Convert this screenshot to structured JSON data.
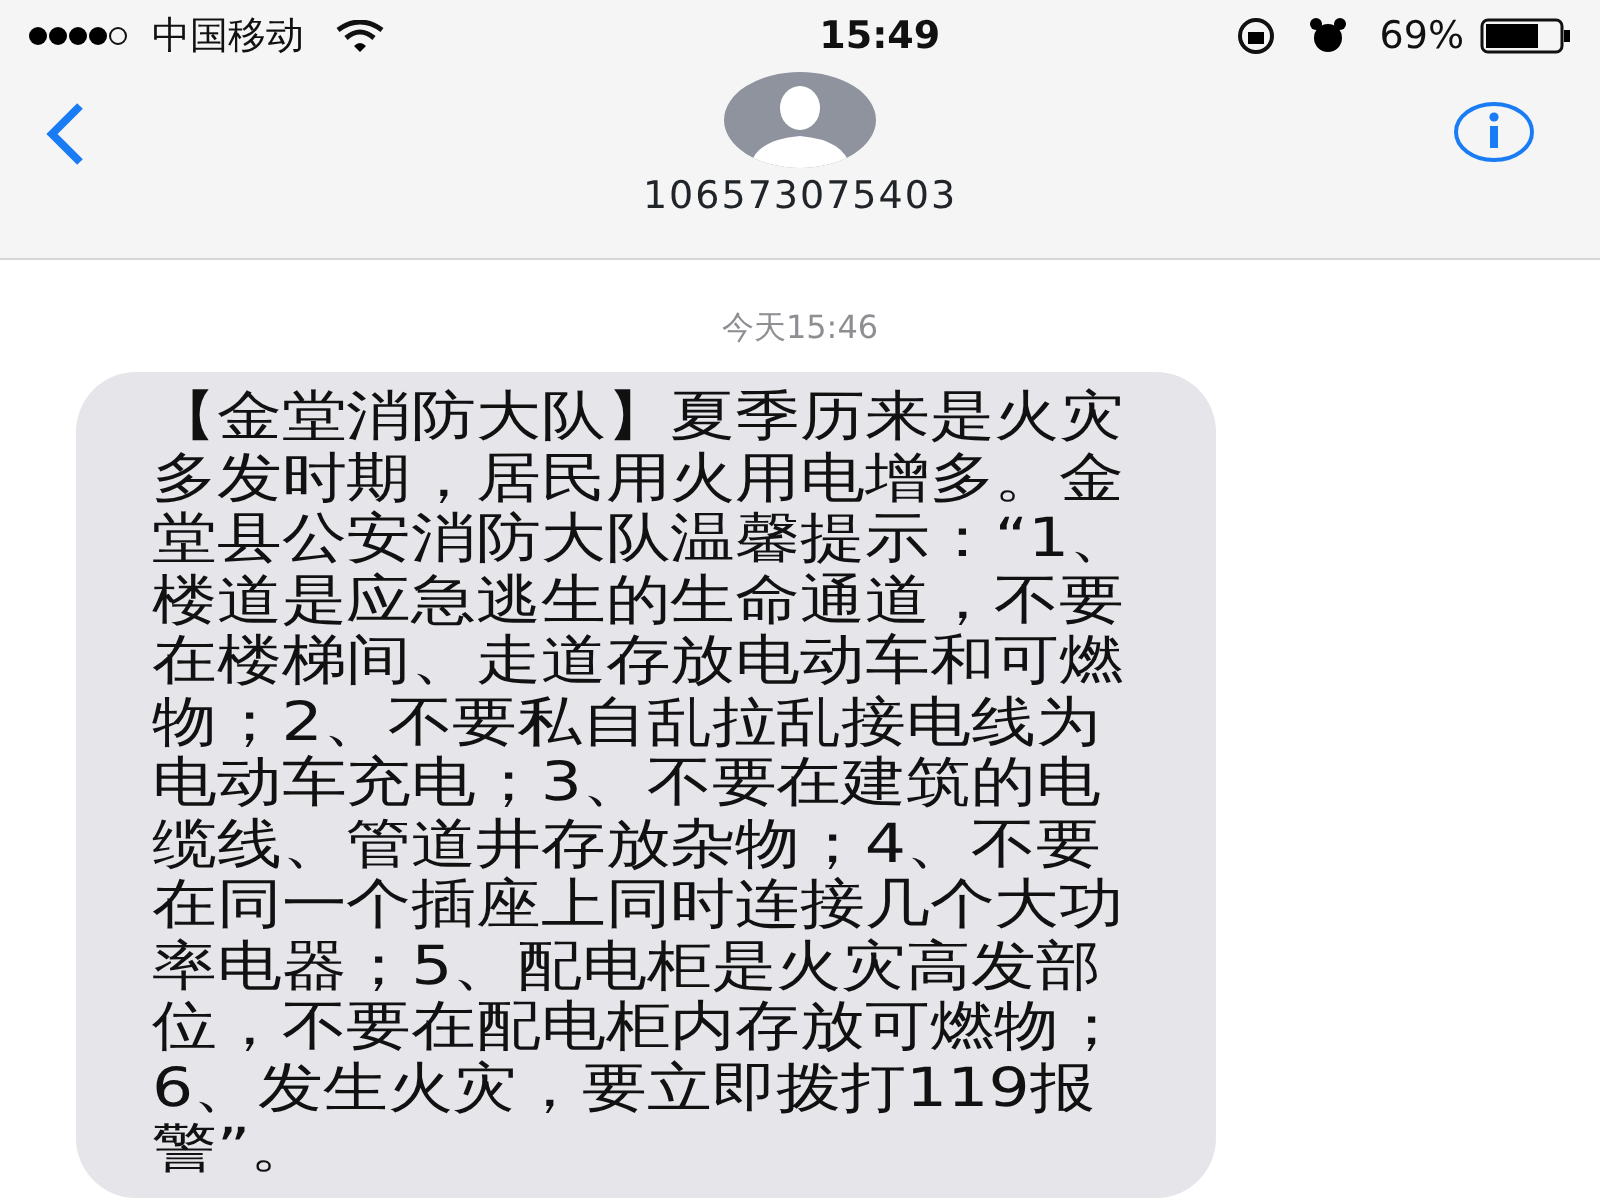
{
  "status_bar": {
    "carrier": "中国移动",
    "time": "15:49",
    "battery": "69%"
  },
  "header": {
    "contact": "106573075403"
  },
  "conversation": {
    "timestamp": "今天15:46",
    "messages": [
      {
        "kind": "incoming",
        "text": "【金堂消防大队】夏季历来是火灾多发时期，居民用火用电增多。金堂县公安消防大队温馨提示：“1、楼道是应急逃生的生命通道，不要在楼梯间、走道存放电动车和可燃物；2、不要私自乱拉乱接电线为电动车充电；3、不要在建筑的电缆线、管道井存放杂物；4、不要在同一个插座上同时连接几个大功率电器；5、配电柜是火灾高发部位，不要在配电柜内存放可燃物；6、发生火灾，要立即拨打119报警”。"
      }
    ]
  }
}
